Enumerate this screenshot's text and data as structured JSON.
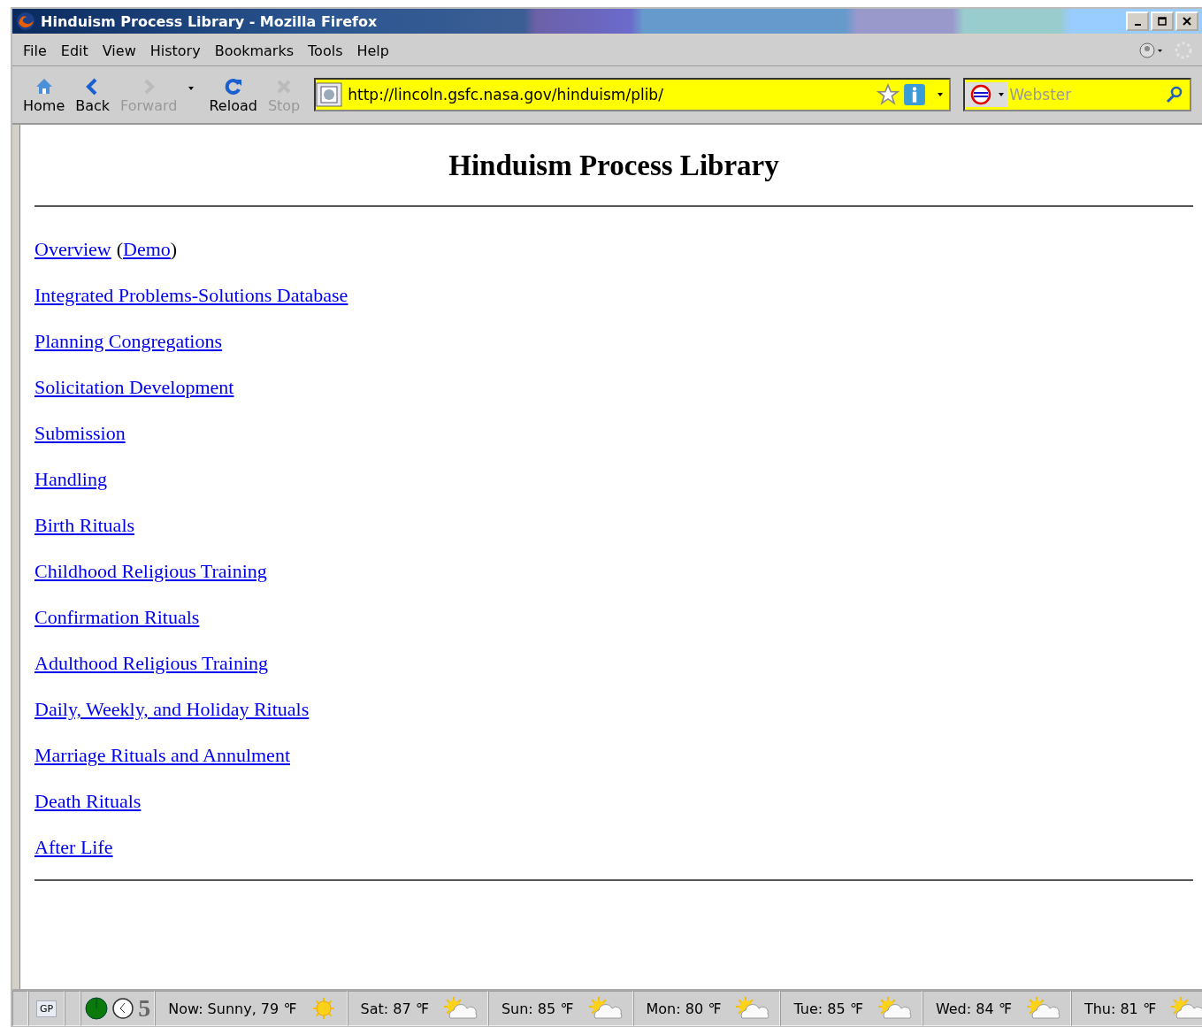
{
  "window": {
    "title": "Hinduism Process Library - Mozilla Firefox"
  },
  "menu": [
    "File",
    "Edit",
    "View",
    "History",
    "Bookmarks",
    "Tools",
    "Help"
  ],
  "toolbar": [
    {
      "kind": "home",
      "label": "Home",
      "disabled": false
    },
    {
      "kind": "back",
      "label": "Back",
      "disabled": false
    },
    {
      "kind": "forward",
      "label": "Forward",
      "disabled": true
    },
    {
      "kind": "reload",
      "label": "Reload",
      "disabled": false
    },
    {
      "kind": "stop",
      "label": "Stop",
      "disabled": true
    }
  ],
  "address": {
    "value": "http://lincoln.gsfc.nasa.gov/hinduism/plib/"
  },
  "search": {
    "placeholder": "Webster"
  },
  "page": {
    "heading": "Hinduism Process Library",
    "rows": [
      [
        {
          "kind": "link",
          "text": "Overview"
        },
        {
          "kind": "text",
          "text": "("
        },
        {
          "kind": "link",
          "text": "Demo"
        },
        {
          "kind": "text",
          "text": ")"
        }
      ],
      [
        {
          "kind": "link",
          "text": "Integrated Problems-Solutions Database"
        }
      ],
      [
        {
          "kind": "link",
          "text": "Planning Congregations"
        }
      ],
      [
        {
          "kind": "link",
          "text": "Solicitation Development"
        }
      ],
      [
        {
          "kind": "link",
          "text": "Submission"
        }
      ],
      [
        {
          "kind": "link",
          "text": "Handling"
        }
      ],
      [
        {
          "kind": "link",
          "text": "Birth Rituals"
        }
      ],
      [
        {
          "kind": "link",
          "text": "Childhood Religious Training"
        }
      ],
      [
        {
          "kind": "link",
          "text": "Confirmation Rituals"
        }
      ],
      [
        {
          "kind": "link",
          "text": "Adulthood Religious Training"
        }
      ],
      [
        {
          "kind": "link",
          "text": "Daily, Weekly, and Holiday Rituals"
        }
      ],
      [
        {
          "kind": "link",
          "text": "Marriage Rituals and Annulment"
        }
      ],
      [
        {
          "kind": "link",
          "text": "Death Rituals"
        }
      ],
      [
        {
          "kind": "link",
          "text": "After Life"
        }
      ]
    ]
  },
  "status_bar": {
    "badge": "GP",
    "count": "5",
    "forecast": [
      {
        "text": "Now: Sunny, 79 ℉",
        "kind": "sun"
      },
      {
        "text": "Sat: 87 ℉",
        "kind": "partly-cloudy"
      },
      {
        "text": "Sun: 85 ℉",
        "kind": "partly-cloudy"
      },
      {
        "text": "Mon: 80 ℉",
        "kind": "partly-cloudy"
      },
      {
        "text": "Tue: 85 ℉",
        "kind": "partly-cloudy"
      },
      {
        "text": "Wed: 84 ℉",
        "kind": "partly-cloudy"
      },
      {
        "text": "Thu: 81 ℉",
        "kind": "partly-cloudy"
      }
    ]
  }
}
